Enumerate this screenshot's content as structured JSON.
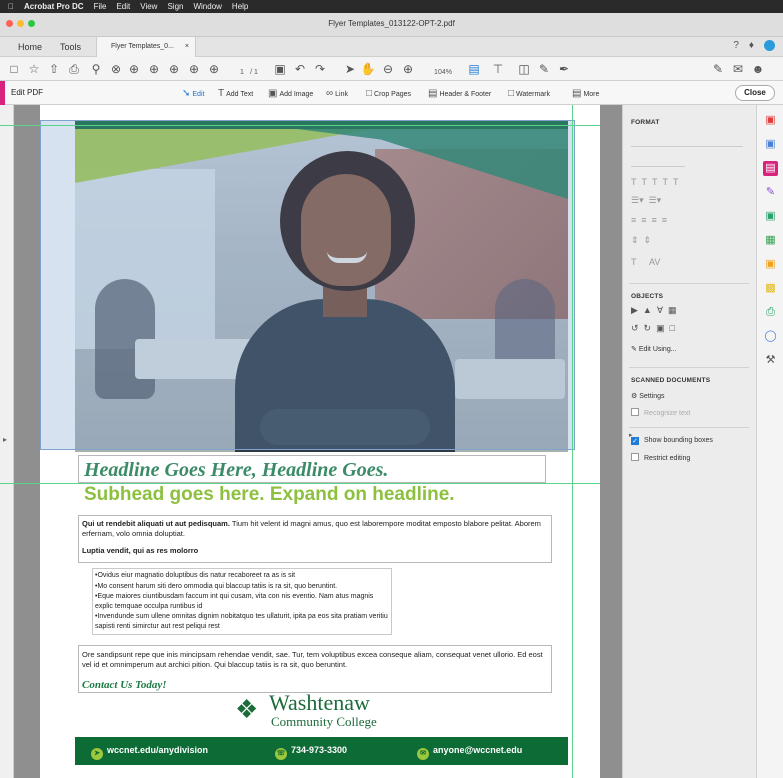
{
  "menubar": {
    "apple": "",
    "app": "Acrobat Pro DC",
    "items": [
      "File",
      "Edit",
      "View",
      "Sign",
      "Window",
      "Help"
    ]
  },
  "window": {
    "title": "Flyer Templates_013122-OPT-2.pdf"
  },
  "tabs": {
    "home": "Home",
    "tools": "Tools",
    "doc": "Flyer Templates_0...",
    "close": "×"
  },
  "toolbar": {
    "page_current": "1",
    "page_total": "/ 1",
    "zoom": "104%"
  },
  "editbar": {
    "label": "Edit PDF",
    "edit": "Edit",
    "add_text": "Add Text",
    "add_image": "Add Image",
    "link": "Link",
    "crop_pages": "Crop Pages",
    "header_footer": "Header & Footer",
    "watermark": "Watermark",
    "more": "More",
    "close": "Close"
  },
  "flyer": {
    "headline": "Headline Goes Here, Headline Goes.",
    "subhead": "Subhead goes here. Expand on headline.",
    "body1_bold": "Qui ut rendebit aliquati ut aut pedisquam.",
    "body1_rest": " Tium hit velent id magni amus, quo est laborempore moditat emposto blabore pelitat. Aborem erfernam, volo omnia doluptiat.",
    "subsection": "Luptia vendit, qui as res molorro",
    "bullets": [
      "•Ovidus eiur magnatio doluptibus dis natur recaboreet ra as is sit",
      "•Mo consent harum siti dero ommodia qui blaccup tatiis is ra sit, quo beruntint.",
      "•Eque maiores ciuntibusdam faccum int qui cusam, vita con nis eventio. Nam atus magnis explic temquae occulpa runtibus id",
      "•Invendunde sum ullene omnitas dignim nobitatquo tes ullaturit, ipita pa eos sita pratiam veritiu sapisti renti simirctur aut rest peliqui rest"
    ],
    "body2": "Ore sandipsunt repe que inis mincipsam rehendae vendit, sae. Tur, tem voluptibus excea conseque aliam, consequat venet ullorio. Ed eost vel id et omnimperum aut archici pition. Qui blaccup tatiis is ra sit, quo beruntint.",
    "contact": "Contact Us Today!",
    "logo_name": "Washtenaw",
    "logo_sub": "Community College",
    "footer_web": "wccnet.edu/anydivision",
    "footer_phone": "734-973-3300",
    "footer_email": "anyone@wccnet.edu"
  },
  "panel": {
    "format": "FORMAT",
    "objects": "OBJECTS",
    "edit_using": "Edit Using...",
    "scanned": "SCANNED DOCUMENTS",
    "settings": "Settings",
    "recognize": "Recognize text",
    "show_bbox": "Show bounding boxes",
    "restrict": "Restrict editing"
  },
  "colors": {
    "accent_pink": "#d6247c",
    "brand_green": "#0d6b35",
    "headline_green": "#3c8b68",
    "subhead_lime": "#8dc03f",
    "link_blue": "#1f7bd6"
  }
}
